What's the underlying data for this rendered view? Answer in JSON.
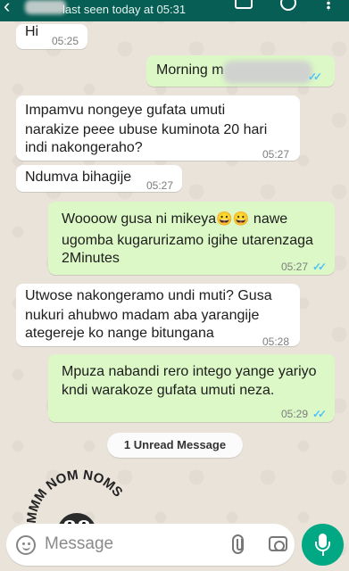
{
  "header": {
    "status": "last seen today at 05:31"
  },
  "messages": [
    {
      "dir": "in",
      "text": "Hi",
      "time": "05:25"
    },
    {
      "dir": "out",
      "text": "Morning m",
      "time": ""
    },
    {
      "dir": "in",
      "line1": "Impamvu nongeye gufata umuti",
      "line2": "narakize  peee ubuse kuminota 20 hari",
      "line3": "indi nakongeraho?",
      "time": "05:27"
    },
    {
      "dir": "in",
      "text": "Ndumva bihagije",
      "time": "05:27"
    },
    {
      "dir": "out",
      "line1": "Woooow gusa ni mikeya",
      "emoji": "😀😀",
      "line1b": " nawe",
      "line2": "ugomba kugarurizamo igihe utarenzaga",
      "line3": "2Minutes",
      "time": "05:27"
    },
    {
      "dir": "in",
      "line1": "Utwose nakongeramo undi muti?  Gusa",
      "line2": "nukuri ahubwo madam aba yarangije",
      "line3": "ategereje ko nange bitungana",
      "time": "05:28"
    },
    {
      "dir": "out",
      "line1": "Mpuza nabandi rero intego yange yariyo",
      "line2": "kndi warakoze gufata umuti neza.",
      "time": "05:29"
    }
  ],
  "unread_label": "1 Unread Message",
  "sticker_text": "MMM NOM NOMS",
  "composer": {
    "placeholder": "Message"
  },
  "icons": {
    "emoji": "emoji-icon",
    "attach": "attach-icon",
    "camera": "camera-icon",
    "mic": "mic-icon"
  },
  "colors": {
    "header": "#075e54",
    "incoming": "#ffffff",
    "outgoing": "#dcf8c6",
    "read_ticks": "#4fc3f7",
    "mic_button": "#00a884"
  }
}
